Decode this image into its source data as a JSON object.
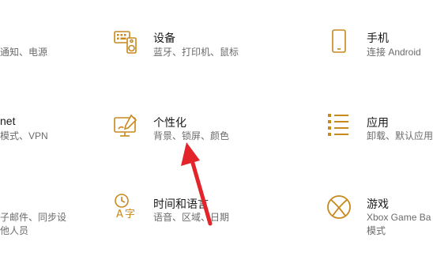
{
  "accent_color": "#c8891c",
  "arrow_color": "#e3242b",
  "col1": {
    "r1_desc": "通知、电源",
    "r2_title": "net",
    "r2_desc": "模式、VPN",
    "r3_desc_line1": "子邮件、同步设",
    "r3_desc_line2": "他人员"
  },
  "items": [
    {
      "title": "设备",
      "desc": "蓝牙、打印机、鼠标",
      "icon": "keyboard-speaker-icon"
    },
    {
      "title": "手机",
      "desc": "连接 Android",
      "icon": "phone-icon"
    },
    {
      "title": "个性化",
      "desc": "背景、锁屏、颜色",
      "icon": "personalization-icon"
    },
    {
      "title": "应用",
      "desc": "卸载、默认应用",
      "icon": "apps-list-icon"
    },
    {
      "title": "时间和语言",
      "desc": "语音、区域、日期",
      "icon": "time-language-icon"
    },
    {
      "title": "游戏",
      "desc_line1": "Xbox Game Ba",
      "desc_line2": "模式",
      "icon": "xbox-icon"
    }
  ]
}
